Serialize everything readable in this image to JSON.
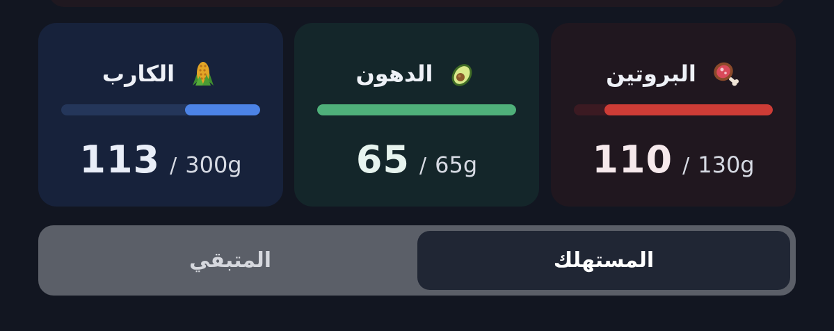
{
  "macros": [
    {
      "key": "protein",
      "title": "البروتين",
      "icon": "meat-icon",
      "consumed": "110",
      "separator": "/",
      "target": "130g",
      "progress": 0.846,
      "colors": {
        "track": "#3b1a22",
        "fill": "#cd3c36",
        "card": "#20171f"
      }
    },
    {
      "key": "fat",
      "title": "الدهون",
      "icon": "avocado-icon",
      "consumed": "65",
      "separator": "/",
      "target": "65g",
      "progress": 1.0,
      "colors": {
        "track": "#1e4a3a",
        "fill": "#4fb07a",
        "card": "#14262a"
      }
    },
    {
      "key": "carbs",
      "title": "الكارب",
      "icon": "corn-icon",
      "consumed": "113",
      "separator": "/",
      "target": "300g",
      "progress": 0.377,
      "colors": {
        "track": "#24365a",
        "fill": "#4c83e6",
        "card": "#17223b"
      }
    }
  ],
  "toggle": {
    "consumed_label": "المستهلك",
    "remaining_label": "المتبقي",
    "selected": "consumed"
  }
}
